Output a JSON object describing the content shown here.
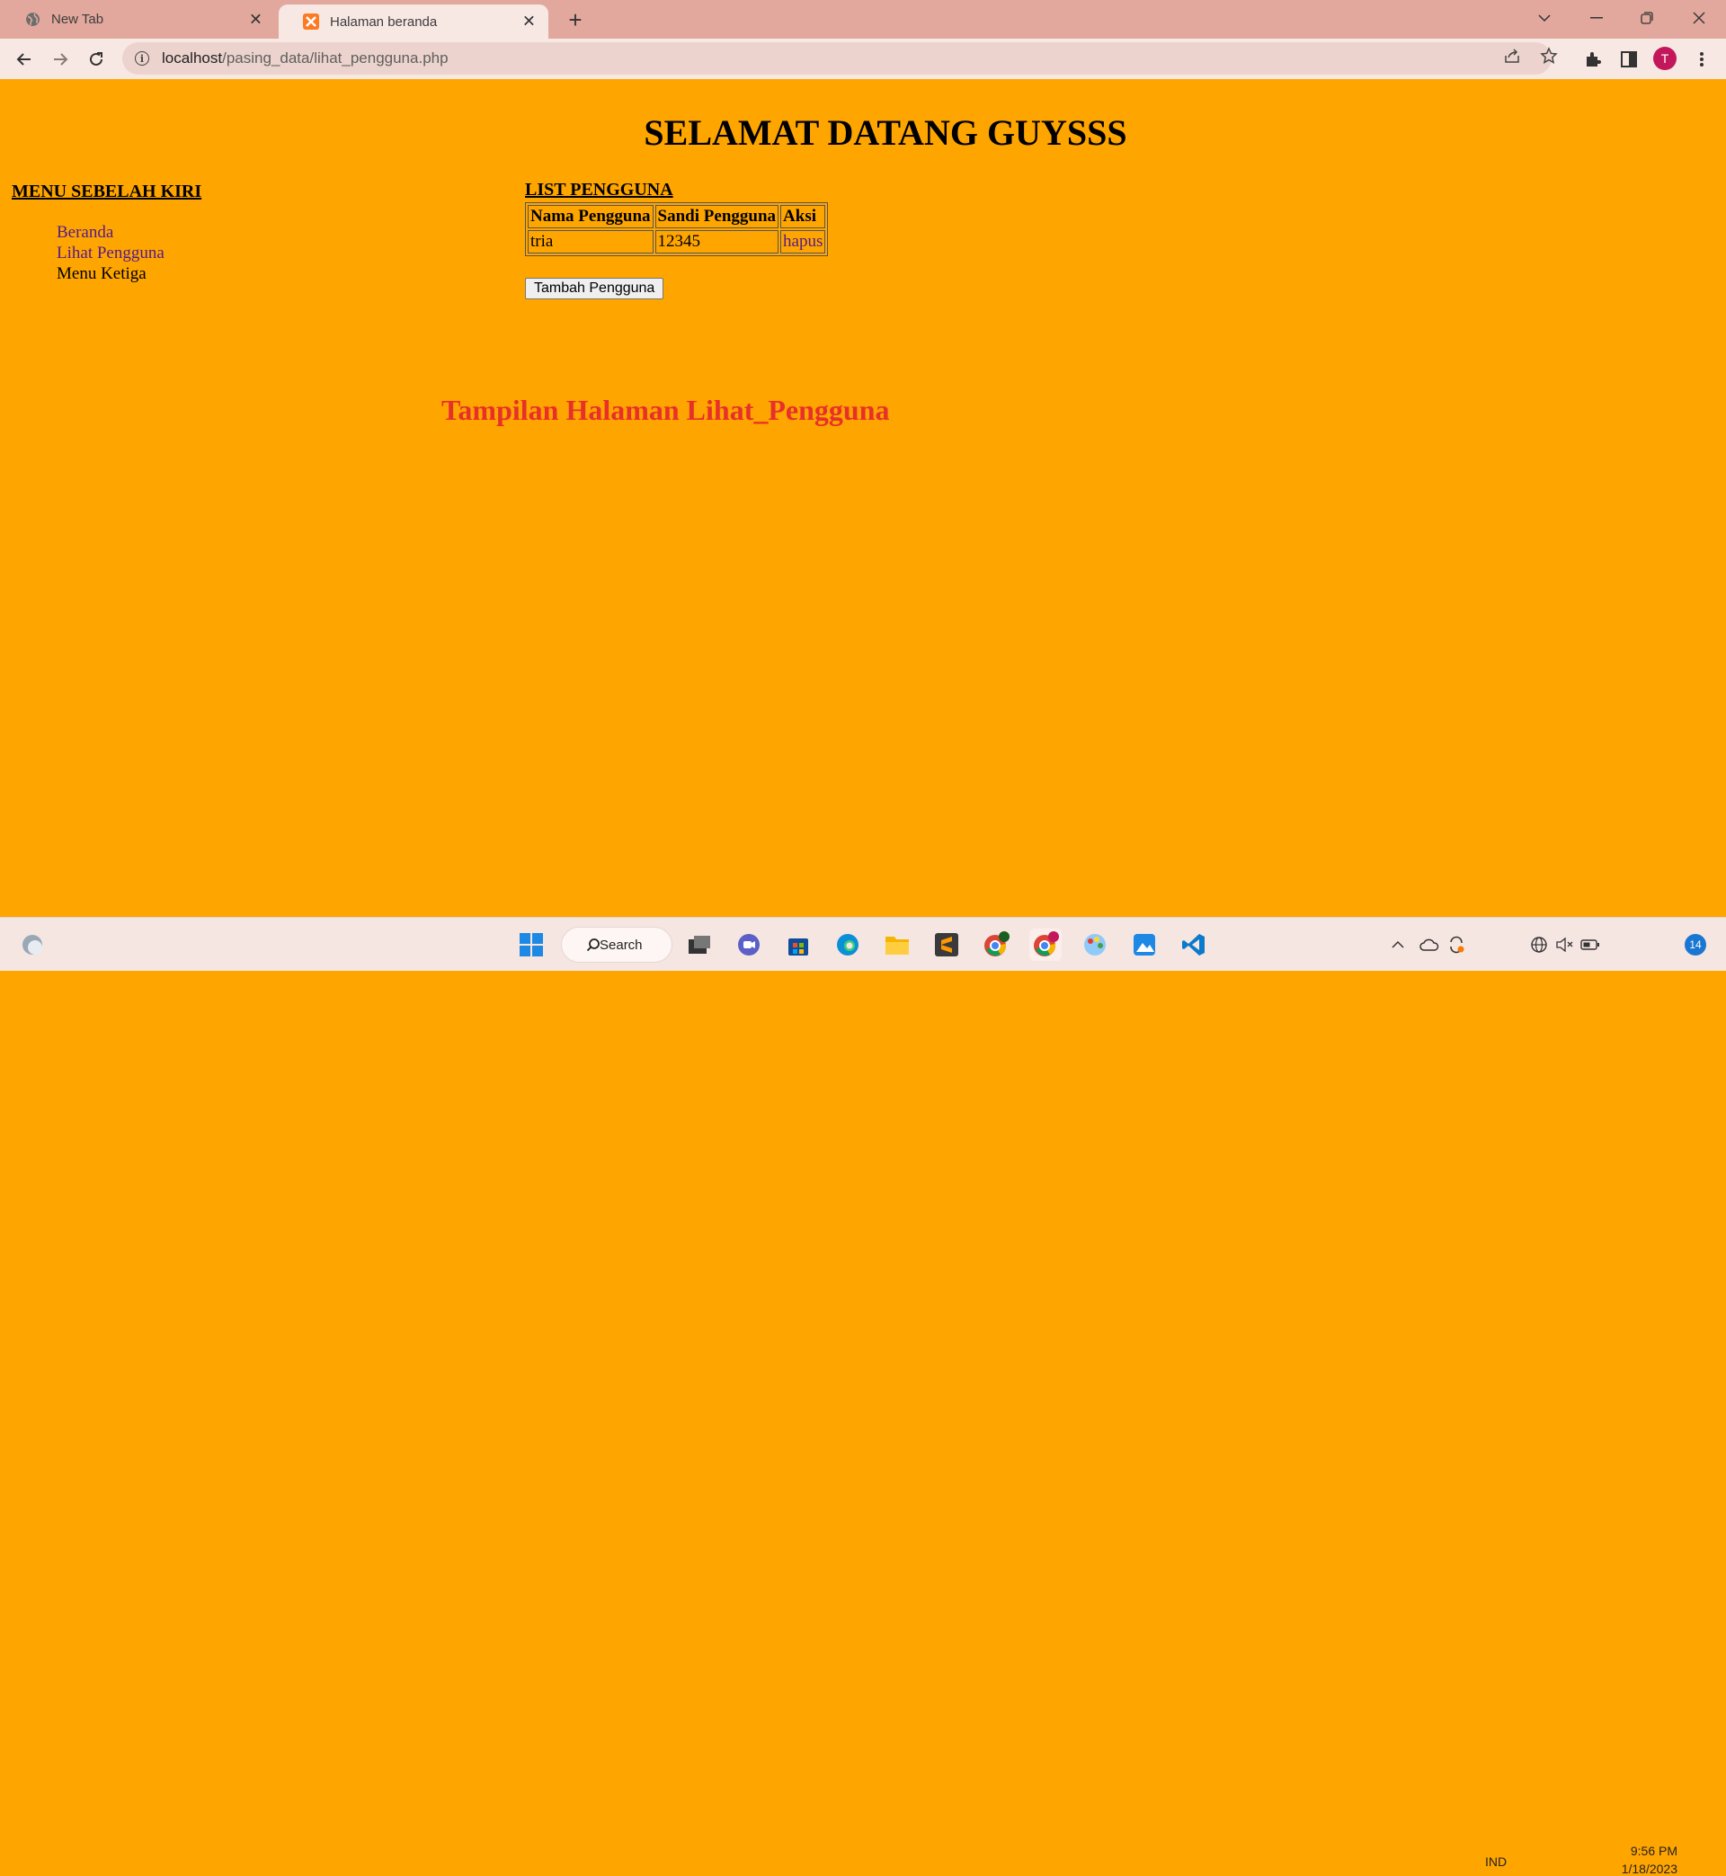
{
  "browser": {
    "tabs": [
      {
        "label": "New Tab"
      },
      {
        "label": "Halaman beranda"
      }
    ],
    "address": {
      "host": "localhost",
      "path": "/pasing_data/lihat_pengguna.php"
    },
    "profile_initial": "T"
  },
  "page": {
    "title": "SELAMAT DATANG GUYSSS",
    "left_menu": {
      "heading": "MENU SEBELAH KIRI",
      "items": [
        {
          "label": "Beranda"
        },
        {
          "label": "Lihat Pengguna"
        },
        {
          "label": "Menu Ketiga"
        }
      ]
    },
    "list": {
      "heading": "LIST PENGGUNA",
      "columns": [
        "Nama Pengguna",
        "Sandi Pengguna",
        "Aksi"
      ],
      "rows": [
        {
          "name": "tria",
          "password": "12345",
          "action": "hapus"
        }
      ],
      "add_button": "Tambah Pengguna"
    },
    "caption": "Tampilan Halaman Lihat_Pengguna"
  },
  "taskbar": {
    "search_label": "Search",
    "language": "IND",
    "time": "9:56 PM",
    "date": "1/18/2023",
    "notification_count": "14"
  },
  "colors": {
    "page_background": "#ffa500",
    "caption": "#e8302a",
    "link": "#551a8b"
  }
}
